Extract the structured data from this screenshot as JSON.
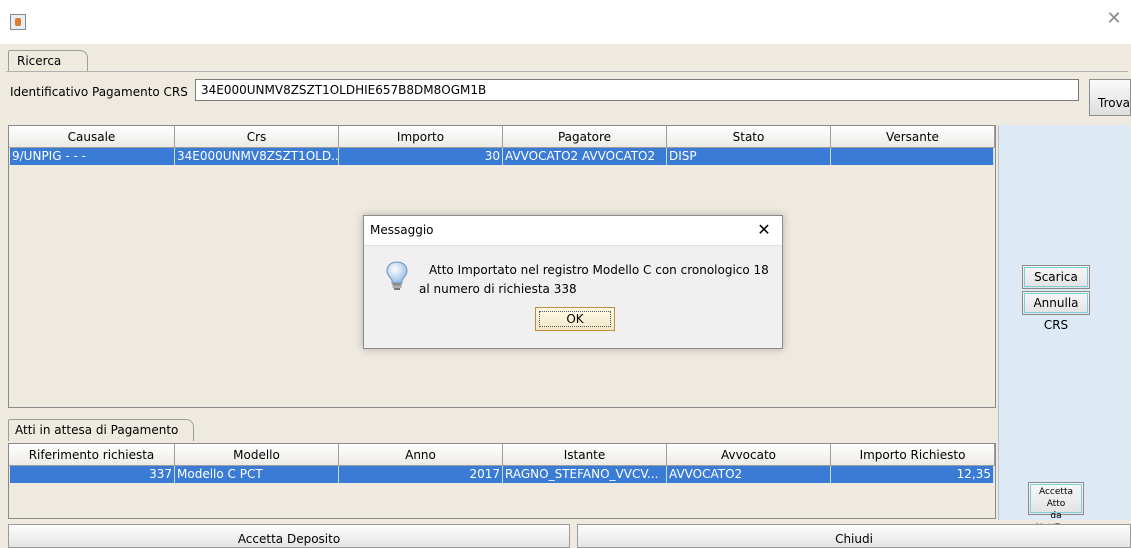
{
  "window": {
    "app_icon": "java-icon",
    "close_icon": "close-icon"
  },
  "tabs": {
    "ricerca": "Ricerca",
    "atti": "Atti in attesa di Pagamento"
  },
  "search": {
    "label": "Identificativo Pagamento CRS",
    "value": "34E000UNMV8ZSZT1OLDHIE657B8DM8OGM1B",
    "button": "Trova"
  },
  "crs_table": {
    "columns": [
      "Causale",
      "Crs",
      "Importo",
      "Pagatore",
      "Stato",
      "Versante"
    ],
    "rows": [
      [
        "9/UNPIG - - -",
        "34E000UNMV8ZSZT1OLD...",
        "30",
        "AVVOCATO2 AVVOCATO2",
        "DISP",
        ""
      ]
    ]
  },
  "side": {
    "scarica": "Scarica CRS",
    "annulla": "Annulla CRS",
    "accetta_atto_1": "Accetta Atto",
    "accetta_atto_2": "da Not/Eseg"
  },
  "atti_table": {
    "columns": [
      "Riferimento richiesta",
      "Modello",
      "Anno",
      "Istante",
      "Avvocato",
      "Importo Richiesto"
    ],
    "rows": [
      [
        "337",
        "Modello C PCT",
        "2017",
        "RAGNO_STEFANO_VVCV...",
        "AVVOCATO2",
        "12,35"
      ]
    ]
  },
  "footer": {
    "accetta_deposito": "Accetta Deposito",
    "chiudi": "Chiudi"
  },
  "dialog": {
    "title": "Messaggio",
    "line1": "Atto Importato nel registro Modello C con cronologico 18",
    "line2": "al numero di richiesta 338",
    "ok": "OK",
    "icon": "lightbulb-icon"
  },
  "colors": {
    "selection": "#3a7bd5",
    "panel": "#eeeae0",
    "side_panel": "#dde9f4"
  }
}
